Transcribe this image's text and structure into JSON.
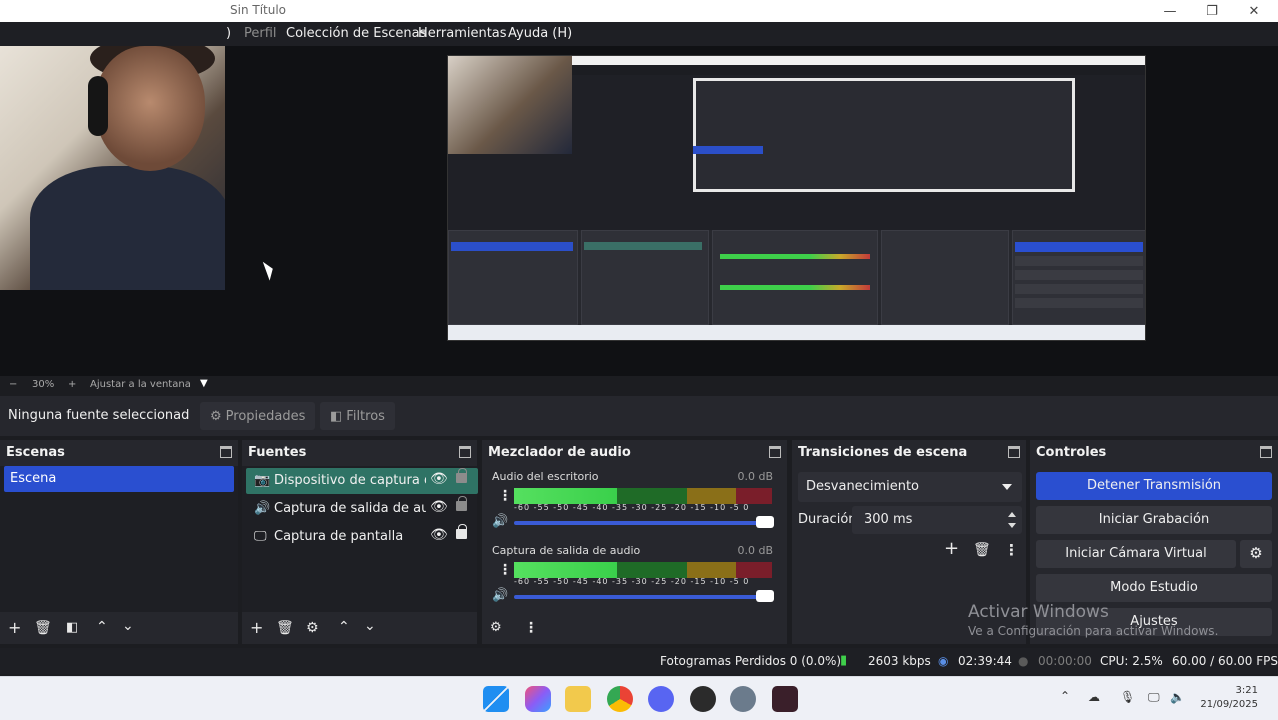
{
  "window": {
    "title": "Sin Título",
    "minimize": "—",
    "maximize": "❐",
    "close": "✕"
  },
  "menu": {
    "partial": ")",
    "items": [
      "Perfil",
      "Colección de Escenas",
      "Herramientas",
      "Ayuda (H)"
    ]
  },
  "zoom": {
    "minus": "−",
    "value": "30%",
    "plus": "+",
    "fit": "Ajustar a la ventana"
  },
  "source_toolbar": {
    "no_source": "Ninguna fuente seleccionad",
    "properties": "Propiedades",
    "filters": "Filtros"
  },
  "scenes": {
    "title": "Escenas",
    "items": [
      "Escena"
    ]
  },
  "sources": {
    "title": "Fuentes",
    "items": [
      {
        "label": "Dispositivo de captura de v",
        "icon": "camera-icon"
      },
      {
        "label": "Captura de salida de audio",
        "icon": "speaker-icon"
      },
      {
        "label": "Captura de pantalla",
        "icon": "monitor-icon"
      }
    ]
  },
  "mixer": {
    "title": "Mezclador de audio",
    "ticks": "-60 -55 -50 -45 -40 -35 -30 -25 -20 -15 -10 -5 0",
    "channels": [
      {
        "name": "Audio del escritorio",
        "db": "0.0 dB",
        "level": 0.4,
        "volume": 1.0
      },
      {
        "name": "Captura de salida de audio",
        "db": "0.0 dB",
        "level": 0.4,
        "volume": 1.0
      }
    ]
  },
  "transitions": {
    "title": "Transiciones de escena",
    "selected": "Desvanecimiento",
    "duration_label": "Duración",
    "duration_value": "300 ms"
  },
  "controls": {
    "title": "Controles",
    "stop_stream": "Detener Transmisión",
    "start_recording": "Iniciar Grabación",
    "virtual_camera": "Iniciar Cámara Virtual",
    "studio_mode": "Modo Estudio",
    "settings": "Ajustes"
  },
  "watermark": {
    "line1": "Activar Windows",
    "line2": "Ve a Configuración para activar Windows."
  },
  "status": {
    "dropped_frames": "Fotogramas Perdidos 0 (0.0%)",
    "bitrate": "2603 kbps",
    "stream_time": "02:39:44",
    "record_time": "00:00:00",
    "cpu": "CPU: 2.5%",
    "fps": "60.00 / 60.00 FPS"
  },
  "clock": {
    "time": "3:21",
    "date": "21/09/2025"
  },
  "colors": {
    "accent_blue": "#2a4fd0",
    "source_selected": "#2f7365",
    "meter_green": "#3ad04b",
    "meter_yellow": "#8a6f18",
    "meter_red": "#7a1e2a"
  }
}
